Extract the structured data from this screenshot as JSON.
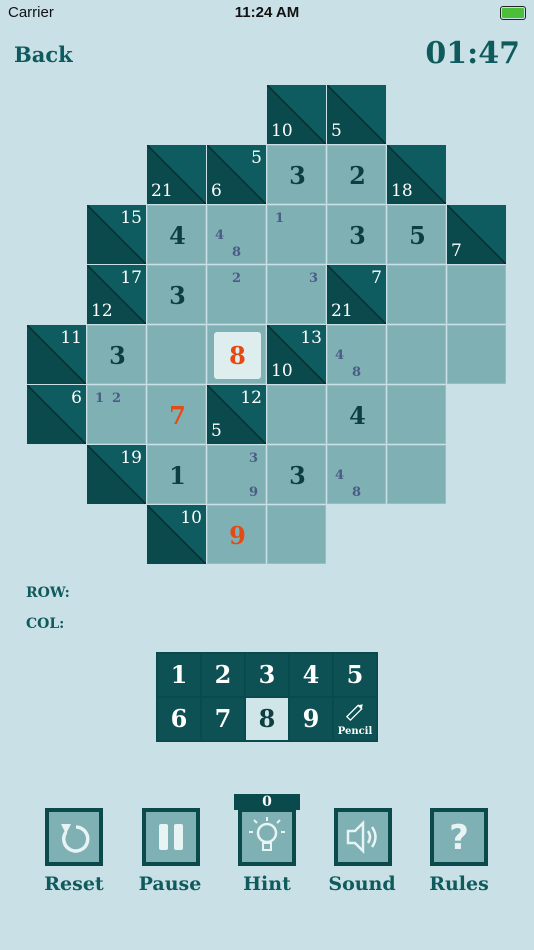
{
  "status": {
    "carrier": "Carrier",
    "time": "11:24 AM"
  },
  "header": {
    "back": "Back",
    "timer": "01:47"
  },
  "board": {
    "blocks": [
      {
        "r": 0,
        "c": 4,
        "down": "10"
      },
      {
        "r": 0,
        "c": 5,
        "down": "5"
      },
      {
        "r": 1,
        "c": 2,
        "down": "21"
      },
      {
        "r": 1,
        "c": 3,
        "across": "5",
        "down": "6"
      },
      {
        "r": 1,
        "c": 6,
        "down": "18"
      },
      {
        "r": 2,
        "c": 1,
        "across": "15"
      },
      {
        "r": 2,
        "c": 7,
        "down": "7"
      },
      {
        "r": 3,
        "c": 1,
        "across": "17",
        "down": "12"
      },
      {
        "r": 3,
        "c": 5,
        "across": "7",
        "down": "21"
      },
      {
        "r": 4,
        "c": 0,
        "across": "11"
      },
      {
        "r": 4,
        "c": 4,
        "across": "13",
        "down": "10"
      },
      {
        "r": 5,
        "c": 0,
        "across": "6"
      },
      {
        "r": 5,
        "c": 3,
        "across": "12",
        "down": "5"
      },
      {
        "r": 6,
        "c": 1,
        "across": "19"
      },
      {
        "r": 7,
        "c": 2,
        "across": "10"
      }
    ],
    "whites": [
      {
        "r": 1,
        "c": 4,
        "value": "3"
      },
      {
        "r": 1,
        "c": 5,
        "value": "2"
      },
      {
        "r": 2,
        "c": 2,
        "value": "4"
      },
      {
        "r": 2,
        "c": 3,
        "pencil": [
          "4",
          "8"
        ]
      },
      {
        "r": 2,
        "c": 4,
        "pencil": [
          "1"
        ]
      },
      {
        "r": 2,
        "c": 5,
        "value": "3"
      },
      {
        "r": 2,
        "c": 6,
        "value": "5"
      },
      {
        "r": 3,
        "c": 2,
        "value": "3"
      },
      {
        "r": 3,
        "c": 3,
        "pencil": [
          "2"
        ]
      },
      {
        "r": 3,
        "c": 4,
        "pencil": [
          "3"
        ]
      },
      {
        "r": 3,
        "c": 6
      },
      {
        "r": 3,
        "c": 7
      },
      {
        "r": 4,
        "c": 1,
        "value": "3"
      },
      {
        "r": 4,
        "c": 2
      },
      {
        "r": 4,
        "c": 3,
        "value": "8",
        "red": true,
        "selected": true
      },
      {
        "r": 4,
        "c": 5,
        "pencil": [
          "4",
          "8"
        ]
      },
      {
        "r": 4,
        "c": 6
      },
      {
        "r": 4,
        "c": 7
      },
      {
        "r": 5,
        "c": 1,
        "pencil": [
          "1",
          "2"
        ]
      },
      {
        "r": 5,
        "c": 2,
        "value": "7",
        "red": true
      },
      {
        "r": 5,
        "c": 4
      },
      {
        "r": 5,
        "c": 5,
        "value": "4"
      },
      {
        "r": 5,
        "c": 6
      },
      {
        "r": 6,
        "c": 2,
        "value": "1"
      },
      {
        "r": 6,
        "c": 3,
        "pencil": [
          "3",
          "9"
        ]
      },
      {
        "r": 6,
        "c": 4,
        "value": "3"
      },
      {
        "r": 6,
        "c": 5,
        "pencil": [
          "4",
          "8"
        ]
      },
      {
        "r": 6,
        "c": 6
      },
      {
        "r": 7,
        "c": 3,
        "value": "9",
        "red": true
      },
      {
        "r": 7,
        "c": 4
      }
    ]
  },
  "info": {
    "row_label": "ROW:",
    "col_label": "COL:"
  },
  "keypad": {
    "keys": [
      "1",
      "2",
      "3",
      "4",
      "5",
      "6",
      "7",
      "8",
      "9"
    ],
    "selected": "8",
    "pencil_label": "Pencil"
  },
  "hint_count": "0",
  "buttons": [
    {
      "label": "Reset",
      "icon": "reset-icon"
    },
    {
      "label": "Pause",
      "icon": "pause-icon"
    },
    {
      "label": "Hint",
      "icon": "lightbulb-icon"
    },
    {
      "label": "Sound",
      "icon": "speaker-icon"
    },
    {
      "label": "Rules",
      "icon": "question-icon"
    }
  ],
  "colors": {
    "background": "#c9e1e6",
    "dark_cell": "#0a4a4d",
    "white_cell": "#7fb0b4",
    "user_digit": "#e64a14"
  }
}
